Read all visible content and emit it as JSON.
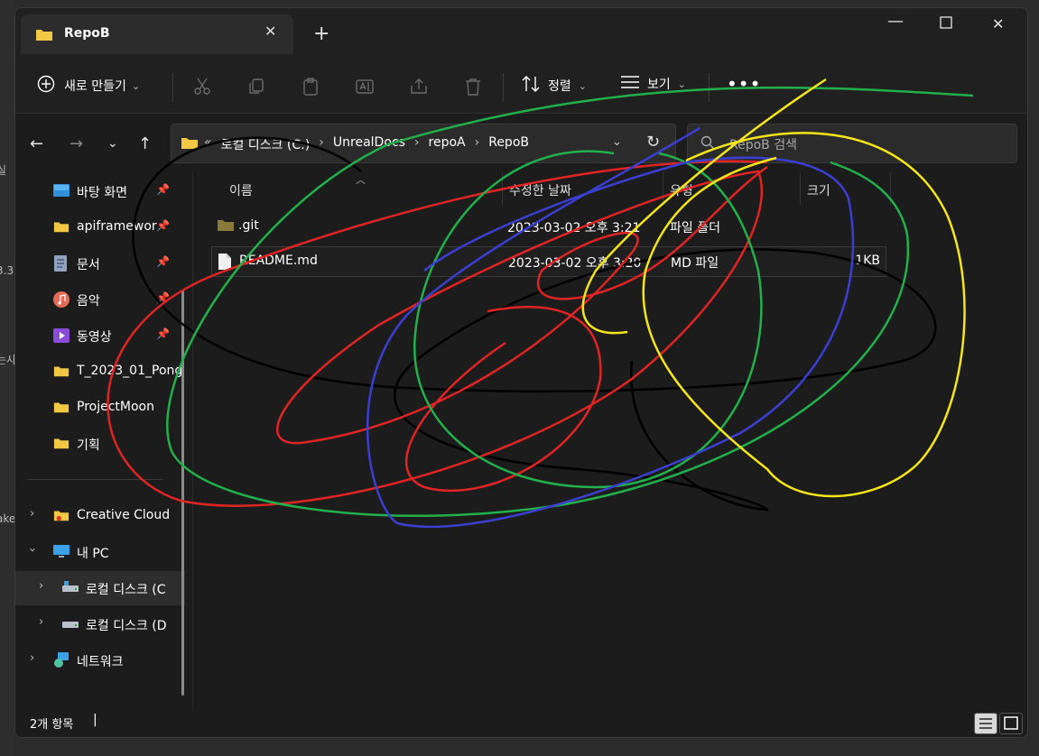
{
  "tab": {
    "title": "RepoB"
  },
  "toolbar": {
    "new_label": "새로 만들기",
    "sort_label": "정렬",
    "view_label": "보기",
    "more_label": "•••"
  },
  "address": {
    "overflow": "«",
    "crumbs": [
      "로컬 디스크 (C:)",
      "UnrealDocs",
      "repoA",
      "RepoB"
    ]
  },
  "search": {
    "placeholder": "RepoB 검색"
  },
  "sidebar": {
    "quick": [
      {
        "label": "바탕 화면",
        "icon": "desktop-icon",
        "pinned": true
      },
      {
        "label": "apiframewor",
        "icon": "folder-icon",
        "pinned": true
      },
      {
        "label": "문서",
        "icon": "document-icon",
        "pinned": true
      },
      {
        "label": "음악",
        "icon": "music-icon",
        "pinned": true
      },
      {
        "label": "동영상",
        "icon": "video-icon",
        "pinned": true
      },
      {
        "label": "T_2023_01_Pong",
        "icon": "folder-icon",
        "pinned": false
      },
      {
        "label": "ProjectMoon",
        "icon": "folder-icon",
        "pinned": false
      },
      {
        "label": "기획",
        "icon": "folder-icon",
        "pinned": false
      }
    ],
    "tree": [
      {
        "label": "Creative Cloud",
        "icon": "creative-cloud-icon"
      },
      {
        "label": "내 PC",
        "icon": "pc-icon"
      },
      {
        "label": "로컬 디스크 (C",
        "icon": "drive-icon"
      },
      {
        "label": "로컬 디스크 (D",
        "icon": "drive-icon"
      },
      {
        "label": "네트워크",
        "icon": "network-icon"
      }
    ]
  },
  "columns": {
    "name": "이름",
    "modified": "수정한 날짜",
    "type": "유형",
    "size": "크기"
  },
  "files": [
    {
      "name": ".git",
      "modified": "2023-03-02 오후 3:21",
      "type": "파일 폴더",
      "size": ""
    },
    {
      "name": "README.md",
      "modified": "2023-03-02 오후 3:20",
      "type": "MD 파일",
      "size": "1KB"
    }
  ],
  "status": {
    "count": "2개 항목",
    "cursor": "|"
  },
  "background_text": [
    "실",
    "3.3",
    "는사",
    "ake"
  ],
  "colors": {
    "background": "#1c1c1c",
    "folder": "#f2c744",
    "scribble_red": "#e02424",
    "scribble_green": "#21b04b",
    "scribble_blue": "#3b3fd1",
    "scribble_yellow": "#f5e61a",
    "scribble_black": "#000000"
  }
}
